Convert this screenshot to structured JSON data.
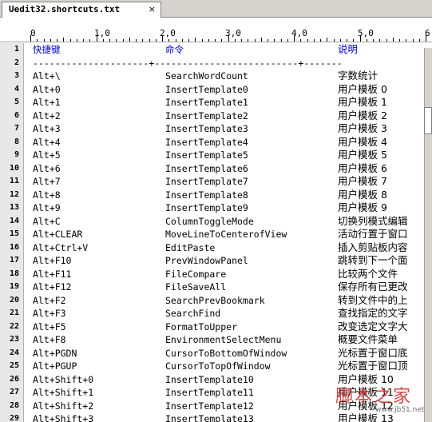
{
  "tab": {
    "title": "Uedit32.shortcuts.txt",
    "close": "×"
  },
  "ruler": [
    "0",
    "1,0",
    "2,0",
    "3,0",
    "4,0",
    "5,0",
    "6"
  ],
  "header": {
    "key": "快捷键",
    "command": "命令",
    "desc": "说明"
  },
  "separator": "---------------------+--------------------------+-------",
  "rows": [
    [
      "Alt+\\",
      "SearchWordCount",
      "字数统计"
    ],
    [
      "Alt+0",
      "InsertTemplate0",
      "用户模板 0"
    ],
    [
      "Alt+1",
      "InsertTemplate1",
      "用户模板 1"
    ],
    [
      "Alt+2",
      "InsertTemplate2",
      "用户模板 2"
    ],
    [
      "Alt+3",
      "InsertTemplate3",
      "用户模板 3"
    ],
    [
      "Alt+4",
      "InsertTemplate4",
      "用户模板 4"
    ],
    [
      "Alt+5",
      "InsertTemplate5",
      "用户模板 5"
    ],
    [
      "Alt+6",
      "InsertTemplate6",
      "用户模板 6"
    ],
    [
      "Alt+7",
      "InsertTemplate7",
      "用户模板 7"
    ],
    [
      "Alt+8",
      "InsertTemplate8",
      "用户模板 8"
    ],
    [
      "Alt+9",
      "InsertTemplate9",
      "用户模板 9"
    ],
    [
      "Alt+C",
      "ColumnToggleMode",
      "切换列模式编辑"
    ],
    [
      "Alt+CLEAR",
      "MoveLineToCenterofView",
      "活动行置于窗口"
    ],
    [
      "Alt+Ctrl+V",
      "EditPaste",
      "插入剪贴板内容"
    ],
    [
      "Alt+F10",
      "PrevWindowPanel",
      "跳转到下一个面"
    ],
    [
      "Alt+F11",
      "FileCompare",
      "比较两个文件"
    ],
    [
      "Alt+F12",
      "FileSaveAll",
      "保存所有已更改"
    ],
    [
      "Alt+F2",
      "SearchPrevBookmark",
      "转到文件中的上"
    ],
    [
      "Alt+F3",
      "SearchFind",
      "查找指定的文字"
    ],
    [
      "Alt+F5",
      "FormatToUpper",
      "改变选定文字大"
    ],
    [
      "Alt+F8",
      "EnvironmentSelectMenu",
      "概要文件菜单"
    ],
    [
      "Alt+PGDN",
      "CursorToBottomOfWindow",
      "光标置于窗口底"
    ],
    [
      "Alt+PGUP",
      "CursorToTopOfWindow",
      "光标置于窗口顶"
    ],
    [
      "Alt+Shift+0",
      "InsertTemplate10",
      "用户模板 10"
    ],
    [
      "Alt+Shift+1",
      "InsertTemplate11",
      "用户模板 11"
    ],
    [
      "Alt+Shift+2",
      "InsertTemplate12",
      "用户模板 12"
    ],
    [
      "Alt+Shift+3",
      "InsertTemplate13",
      "用户模板 13"
    ]
  ],
  "watermark": {
    "text": "脚本之家",
    "sub": "www.jb51.net"
  }
}
